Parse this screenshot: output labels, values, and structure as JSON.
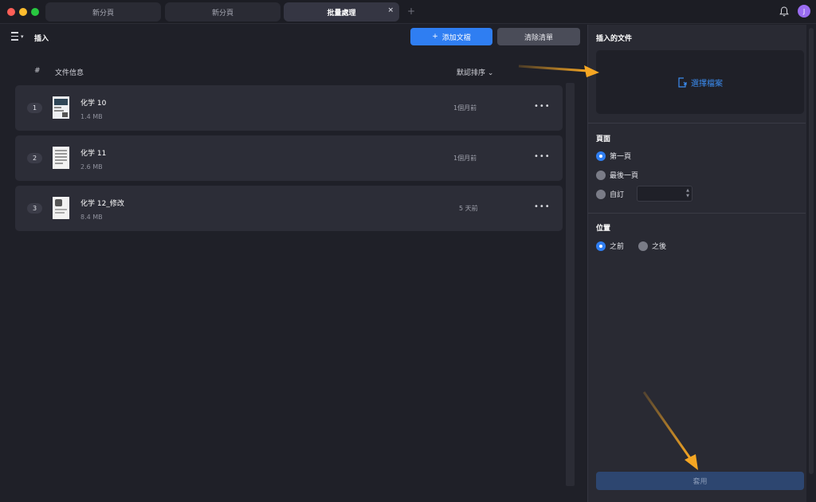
{
  "tabs": [
    {
      "label": "新分頁"
    },
    {
      "label": "新分頁"
    },
    {
      "label": "批量處理"
    }
  ],
  "tab_close": "×",
  "tab_plus": "+",
  "avatar_initial": "J",
  "left": {
    "title": "插入",
    "add_button": "添加文檔",
    "add_plus": "+",
    "clear_button": "清除清單",
    "columns": {
      "num": "#",
      "info": "文件信息"
    },
    "sort_label": "默認排序",
    "sort_chevron": "⌄",
    "files": [
      {
        "num": "1",
        "name": "化学 10",
        "size": "1.4 MB",
        "time": "1個月前"
      },
      {
        "num": "2",
        "name": "化学 11",
        "size": "2.6 MB",
        "time": "1個月前"
      },
      {
        "num": "3",
        "name": "化学 12_修改",
        "size": "8.4 MB",
        "time": "5 天前"
      }
    ],
    "more": "•••"
  },
  "right": {
    "insert_title": "插入的文件",
    "choose_file": "選擇檔案",
    "pages_title": "頁面",
    "page_options": [
      "第一頁",
      "最後一頁",
      "自訂"
    ],
    "page_selected": "第一頁",
    "position_title": "位置",
    "position_options": [
      "之前",
      "之後"
    ],
    "position_selected": "之前",
    "apply_button": "套用"
  },
  "colors": {
    "accent": "#2f7ef2",
    "annotation_arrow": "#f5a623",
    "avatar": "#9a6cf1"
  },
  "icons": [
    "menu-icon",
    "bell-icon",
    "plus-icon",
    "file-add-icon",
    "more-icon",
    "chevron-down-icon"
  ]
}
